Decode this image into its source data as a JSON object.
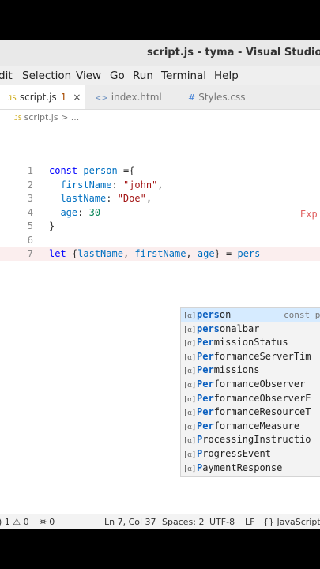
{
  "window": {
    "title": "script.js - tyma - Visual Studio Code"
  },
  "menu": [
    "dit",
    "Selection",
    "View",
    "Go",
    "Run",
    "Terminal",
    "Help"
  ],
  "tabs": [
    {
      "icon": "JS",
      "label": "script.js",
      "badge": "1",
      "close": "×",
      "active": true
    },
    {
      "icon": "<>",
      "label": "index.html",
      "active": false
    },
    {
      "icon": "#",
      "label": "Styles.css",
      "active": false
    }
  ],
  "breadcrumb": {
    "icon": "JS",
    "text": "script.js > ..."
  },
  "editor": {
    "lines": [
      {
        "n": "1",
        "tokens": [
          [
            "kw",
            "const "
          ],
          [
            "id",
            "person "
          ],
          [
            "pun",
            "={"
          ]
        ]
      },
      {
        "n": "2",
        "tokens": [
          [
            "pun",
            "  "
          ],
          [
            "id",
            "firstName"
          ],
          [
            "pun",
            ": "
          ],
          [
            "str",
            "\"john\""
          ],
          [
            "pun",
            ","
          ]
        ]
      },
      {
        "n": "3",
        "tokens": [
          [
            "pun",
            "  "
          ],
          [
            "id",
            "lastName"
          ],
          [
            "pun",
            ": "
          ],
          [
            "str",
            "\"Doe\""
          ],
          [
            "pun",
            ","
          ]
        ]
      },
      {
        "n": "4",
        "tokens": [
          [
            "pun",
            "  "
          ],
          [
            "id",
            "age"
          ],
          [
            "pun",
            ": "
          ],
          [
            "numv",
            "30"
          ]
        ]
      },
      {
        "n": "5",
        "tokens": [
          [
            "pun",
            "}"
          ]
        ]
      },
      {
        "n": "6",
        "tokens": []
      },
      {
        "n": "7",
        "tokens": [
          [
            "kw",
            "let "
          ],
          [
            "pun",
            "{"
          ],
          [
            "id",
            "lastName"
          ],
          [
            "pun",
            ", "
          ],
          [
            "id",
            "firstName"
          ],
          [
            "pun",
            ", "
          ],
          [
            "id",
            "age"
          ],
          [
            "pun",
            "} = "
          ],
          [
            "id",
            "pers"
          ]
        ]
      }
    ],
    "error_hint": "Exp"
  },
  "suggestions": [
    {
      "label": "person",
      "match": "pers",
      "detail": "const p",
      "selected": true
    },
    {
      "label": "personalbar",
      "match": "pers"
    },
    {
      "label": "PermissionStatus",
      "match": "Per"
    },
    {
      "label": "PerformanceServerTim",
      "match": "Per"
    },
    {
      "label": "Permissions",
      "match": "Per"
    },
    {
      "label": "PerformanceObserver",
      "match": "Per"
    },
    {
      "label": "PerformanceObserverE",
      "match": "Per"
    },
    {
      "label": "PerformanceResourceT",
      "match": "Per"
    },
    {
      "label": "PerformanceMeasure",
      "match": "Per"
    },
    {
      "label": "ProcessingInstructio",
      "match": "P"
    },
    {
      "label": "ProgressEvent",
      "match": "P"
    },
    {
      "label": "PaymentResponse",
      "match": "P"
    }
  ],
  "status": {
    "problems": ") 1 ⚠ 0",
    "ports": "⛯ 0",
    "position": "Ln 7, Col 37",
    "spaces": "Spaces: 2",
    "encoding": "UTF-8",
    "eol": "LF",
    "language": "{} JavaScript"
  }
}
